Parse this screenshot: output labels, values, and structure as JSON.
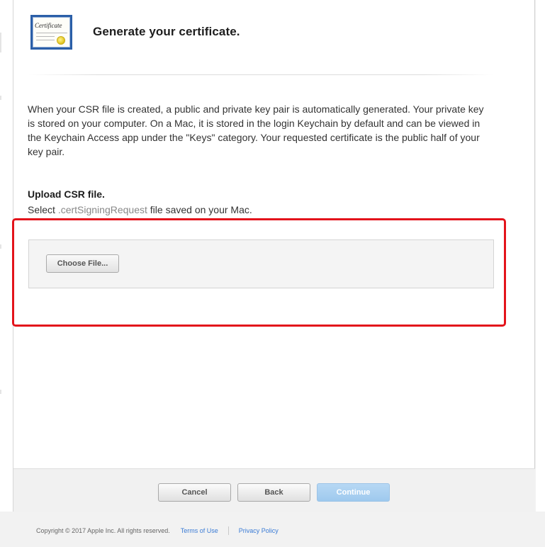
{
  "header": {
    "icon_name": "certificate-icon",
    "icon_text": "Certificate",
    "title": "Generate your certificate."
  },
  "description": "When your CSR file is created, a public and private key pair is automatically generated. Your private key is stored on your computer. On a Mac, it is stored in the login Keychain by default and can be viewed in the Keychain Access app under the \"Keys\" category. Your requested certificate is the public half of your key pair.",
  "upload": {
    "heading": "Upload CSR file.",
    "instruction_prefix": "Select ",
    "extension": ".certSigningRequest",
    "instruction_suffix": " file saved on your Mac.",
    "choose_file_label": "Choose File..."
  },
  "actions": {
    "cancel_label": "Cancel",
    "back_label": "Back",
    "continue_label": "Continue"
  },
  "footer": {
    "copyright": "Copyright © 2017 Apple Inc. All rights reserved.",
    "terms_label": "Terms of Use",
    "privacy_label": "Privacy Policy"
  },
  "colors": {
    "highlight_border": "#e3131b",
    "continue_button": "#9ec9ee",
    "link": "#3a7bd5",
    "certificate_border": "#2b5fa8"
  }
}
